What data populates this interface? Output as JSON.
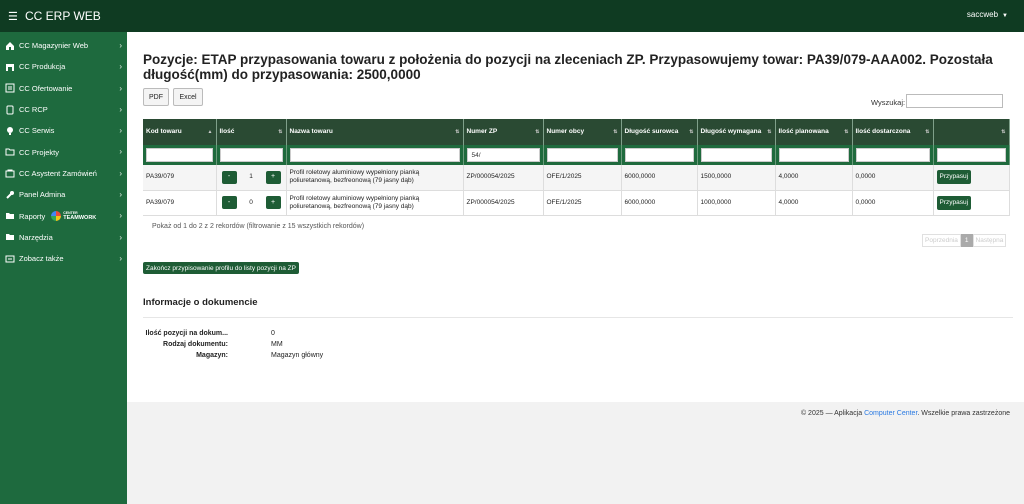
{
  "app": {
    "title": "CC ERP WEB",
    "user": "saccweb"
  },
  "sidebar": {
    "items": [
      {
        "label": "CC Magazynier Web",
        "icon": "home-icon"
      },
      {
        "label": "CC Produkcja",
        "icon": "warehouse-icon"
      },
      {
        "label": "CC Ofertowanie",
        "icon": "list-icon"
      },
      {
        "label": "CC RCP",
        "icon": "tablet-icon"
      },
      {
        "label": "CC Serwis",
        "icon": "bulb-icon"
      },
      {
        "label": "CC Projekty",
        "icon": "folder-icon"
      },
      {
        "label": "CC Asystent Zamówień",
        "icon": "cart-icon"
      },
      {
        "label": "Panel Admina",
        "icon": "wrench-icon"
      },
      {
        "label": "Raporty",
        "icon": "folder-icon",
        "badge_top": "CENTER",
        "badge": "TEAMWORK"
      },
      {
        "label": "Narzędzia",
        "icon": "folder-icon"
      },
      {
        "label": "Zobacz także",
        "icon": "link-icon"
      }
    ]
  },
  "page": {
    "title": "Pozycje: ETAP przypasowania towaru z położenia do pozycji na zleceniach ZP. Przypasowujemy towar: PA39/079-AAA002. Pozostała długość(mm) do przypasowania: 2500,0000",
    "pdf_label": "PDF",
    "excel_label": "Excel",
    "search_label": "Wyszukaj:",
    "search_value": ""
  },
  "table": {
    "columns": [
      "Kod towaru",
      "Ilość",
      "Nazwa towaru",
      "Numer ZP",
      "Numer obcy",
      "Długość surowca",
      "Długość wymagana",
      "Ilość planowana",
      "Ilość dostarczona",
      ""
    ],
    "filters": [
      "",
      "",
      "",
      "54/",
      "",
      "",
      "",
      "",
      "",
      ""
    ],
    "rows": [
      {
        "kod": "PA39/079",
        "ilosc": "1",
        "nazwa": "Profil roletowy aluminiowy wypełniony pianką poliuretanową, bezfreonową (79 jasny dąb)",
        "zp": "ZP/000054/2025",
        "obcy": "OFE/1/2025",
        "surowiec": "6000,0000",
        "wymagana": "1500,0000",
        "planowana": "4,0000",
        "dostarczona": "0,0000",
        "action": "Przypasuj"
      },
      {
        "kod": "PA39/079",
        "ilosc": "0",
        "nazwa": "Profil roletowy aluminiowy wypełniony pianką poliuretanową, bezfreonową (79 jasny dąb)",
        "zp": "ZP/000054/2025",
        "obcy": "OFE/1/2025",
        "surowiec": "6000,0000",
        "wymagana": "1000,0000",
        "planowana": "4,0000",
        "dostarczona": "0,0000",
        "action": "Przypasuj"
      }
    ],
    "minus": "-",
    "plus": "+",
    "info": "Pokaż od 1 do 2 z 2 rekordów (filtrowanie z 15 wszystkich rekordów)"
  },
  "pager": {
    "prev": "Poprzednia",
    "current": "1",
    "next": "Następna"
  },
  "finish_button": "Zakończ przypisowanie profilu do listy pozycji na ZP",
  "doc_info": {
    "heading": "Informacje o dokumencie",
    "items": [
      {
        "key": "Ilość pozycji na dokum...",
        "value": "0"
      },
      {
        "key": "Rodzaj dokumentu:",
        "value": "MM"
      },
      {
        "key": "Magazyn:",
        "value": "Magazyn główny"
      }
    ]
  },
  "footer": {
    "prefix": "© 2025 — Aplikacja ",
    "link": "Computer Center",
    "suffix": ". Wszelkie prawa zastrzeżone"
  },
  "colors": {
    "topbar": "#0f3b22",
    "sidebar": "#1e6a3e",
    "table_header": "#2a4a33",
    "accent": "#1e5c35"
  }
}
